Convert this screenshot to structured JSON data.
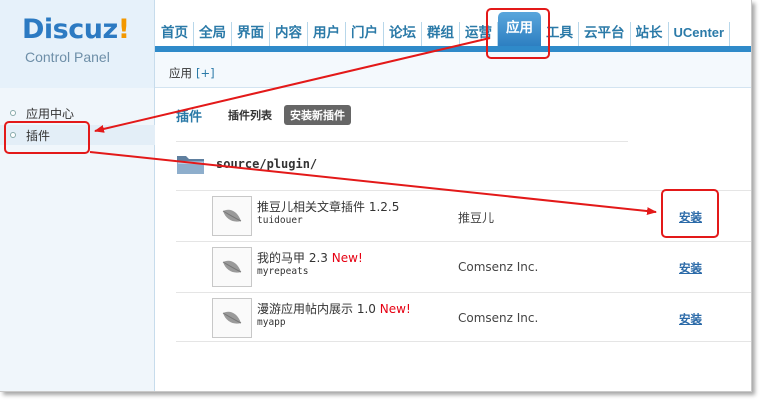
{
  "logo": {
    "name": "Discuz",
    "bang": "!",
    "subtitle": "Control Panel"
  },
  "nav": {
    "items": [
      {
        "label": "首页",
        "name": "nav-item-home"
      },
      {
        "label": "全局",
        "name": "nav-item-global"
      },
      {
        "label": "界面",
        "name": "nav-item-interface"
      },
      {
        "label": "内容",
        "name": "nav-item-content"
      },
      {
        "label": "用户",
        "name": "nav-item-users"
      },
      {
        "label": "门户",
        "name": "nav-item-portal"
      },
      {
        "label": "论坛",
        "name": "nav-item-forum"
      },
      {
        "label": "群组",
        "name": "nav-item-groups"
      },
      {
        "label": "运营",
        "name": "nav-item-operations"
      },
      {
        "label": "应用",
        "name": "nav-item-apps",
        "active": true
      },
      {
        "label": "工具",
        "name": "nav-item-tools"
      },
      {
        "label": "云平台",
        "name": "nav-item-cloud"
      },
      {
        "label": "站长",
        "name": "nav-item-webmaster"
      },
      {
        "label": "UCenter",
        "name": "nav-item-ucenter"
      }
    ]
  },
  "subbar": {
    "title": "应用",
    "plus": "[+]"
  },
  "sidebar": {
    "items": [
      {
        "label": "应用中心",
        "active": false
      },
      {
        "label": "插件",
        "active": true
      }
    ]
  },
  "tabs": {
    "plugin": "插件",
    "list": "插件列表",
    "install_new": "安装新插件"
  },
  "folder": {
    "path": "source/plugin/"
  },
  "plugins": [
    {
      "name": "推豆儿相关文章插件",
      "version": "1.2.5",
      "new": "",
      "id": "tuidouer",
      "author": "推豆儿",
      "action": "安装"
    },
    {
      "name": "我的马甲",
      "version": "2.3",
      "new": "New!",
      "id": "myrepeats",
      "author": "Comsenz Inc.",
      "action": "安装"
    },
    {
      "name": "漫游应用帖内展示",
      "version": "1.0",
      "new": "New!",
      "id": "myapp",
      "author": "Comsenz Inc.",
      "action": "安装"
    }
  ],
  "colors": {
    "accent": "#2f8ac9",
    "annotation": "#e31919",
    "new_badge": "#e60012"
  }
}
